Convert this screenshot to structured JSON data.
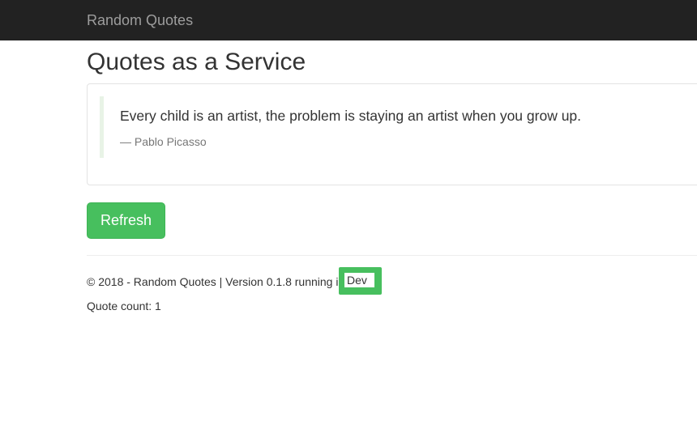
{
  "navbar": {
    "brand": "Random Quotes"
  },
  "main": {
    "title": "Quotes as a Service",
    "quote": {
      "text": "Every child is an artist, the problem is staying an artist when you grow up.",
      "author": "— Pablo Picasso"
    },
    "refresh_label": "Refresh"
  },
  "footer": {
    "text": "© 2018 - Random Quotes | Version 0.1.8 running i",
    "environment": "Dev",
    "quote_count": "Quote count: 1"
  },
  "colors": {
    "navbar_bg": "#222222",
    "accent_green": "#47bf5e"
  }
}
